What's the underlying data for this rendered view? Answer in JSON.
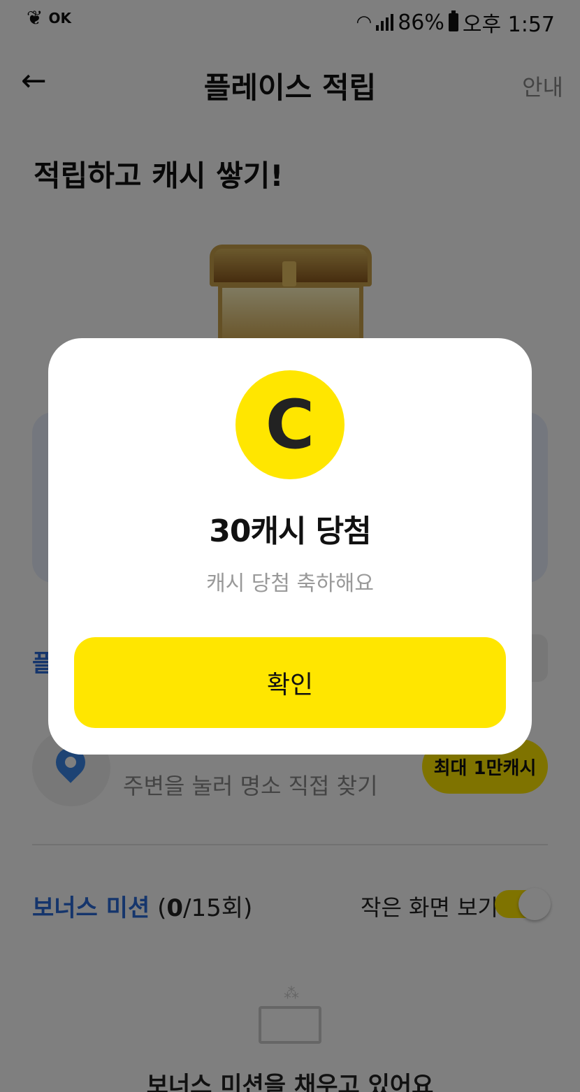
{
  "status_bar": {
    "left_icons": [
      "maple-leaf-icon",
      "ok-cashbag-icon"
    ],
    "ok_text": "OK",
    "battery": "86%",
    "time": "오후 1:57"
  },
  "header": {
    "back_icon": "←",
    "title": "플레이스 적립",
    "guide": "안내"
  },
  "headline": "적립하고 캐시 쌓기!",
  "background": {
    "section_title_fragment": "플",
    "place_mission_sub": "주변을 눌러 명소 직접 찾기",
    "reward_pill": "최대 1만캐시",
    "bonus_title": "보너스 미션",
    "bonus_count_prefix": "(",
    "bonus_count_done": "0",
    "bonus_count_rest": "/15회)",
    "small_view_label": "작은 화면 보기",
    "small_view_on": true,
    "bonus_empty_text": "보너스 미션을 채우고 있어요"
  },
  "modal": {
    "coin_letter": "C",
    "title": "30캐시 당첨",
    "subtitle": "캐시 당첨 축하해요",
    "confirm_label": "확인"
  },
  "colors": {
    "accent_yellow": "#ffe600",
    "accent_blue": "#2a6bd8",
    "overlay": "rgba(0,0,0,0.5)"
  }
}
